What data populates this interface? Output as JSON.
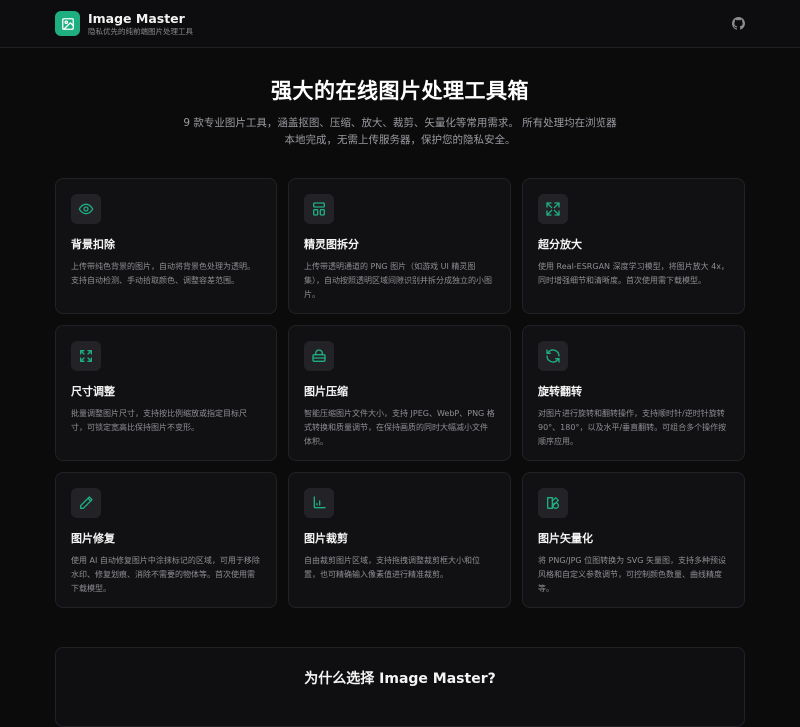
{
  "header": {
    "app_name": "Image Master",
    "tagline": "隐私优先的纯前端图片处理工具",
    "github_icon": "github-icon"
  },
  "hero": {
    "title": "强大的在线图片处理工具箱",
    "description": "9 款专业图片工具，涵盖抠图、压缩、放大、裁剪、矢量化等常用需求。 所有处理均在浏览器本地完成，无需上传服务器，保护您的隐私安全。"
  },
  "tools": [
    {
      "title": "背景扣除",
      "desc": "上传带纯色背景的图片，自动将背景色处理为透明。支持自动检测、手动拾取颜色、调整容差范围。",
      "icon": "eye-icon"
    },
    {
      "title": "精灵图拆分",
      "desc": "上传带透明通道的 PNG 图片（如游戏 UI 精灵图集），自动按照透明区域间隙识别并拆分成独立的小图片。",
      "icon": "layout-icon"
    },
    {
      "title": "超分放大",
      "desc": "使用 Real-ESRGAN 深度学习模型，将图片放大 4x，同时增强细节和清晰度。首次使用需下载模型。",
      "icon": "expand-icon"
    },
    {
      "title": "尺寸调整",
      "desc": "批量调整图片尺寸，支持按比例缩放或指定目标尺寸，可锁定宽高比保持图片不变形。",
      "icon": "resize-icon"
    },
    {
      "title": "图片压缩",
      "desc": "智能压缩图片文件大小，支持 JPEG、WebP、PNG 格式转换和质量调节，在保持画质的同时大幅减小文件体积。",
      "icon": "archive-icon"
    },
    {
      "title": "旋转翻转",
      "desc": "对图片进行旋转和翻转操作，支持顺时针/逆时针旋转 90°、180°，以及水平/垂直翻转。可组合多个操作按顺序应用。",
      "icon": "rotate-icon"
    },
    {
      "title": "图片修复",
      "desc": "使用 AI 自动修复图片中涂抹标记的区域，可用于移除水印、修复划痕、消除不需要的物体等。首次使用需下载模型。",
      "icon": "pencil-icon"
    },
    {
      "title": "图片裁剪",
      "desc": "自由裁剪图片区域，支持拖拽调整裁剪框大小和位置，也可精确输入像素值进行精准裁剪。",
      "icon": "crop-icon"
    },
    {
      "title": "图片矢量化",
      "desc": "将 PNG/JPG 位图转换为 SVG 矢量图，支持多种预设风格和自定义参数调节，可控制颜色数量、曲线精度等。",
      "icon": "shapes-icon"
    }
  ],
  "why": {
    "title": "为什么选择 Image Master?"
  },
  "colors": {
    "accent": "#1fae80",
    "background": "#0b0b0c",
    "card": "#111113"
  }
}
